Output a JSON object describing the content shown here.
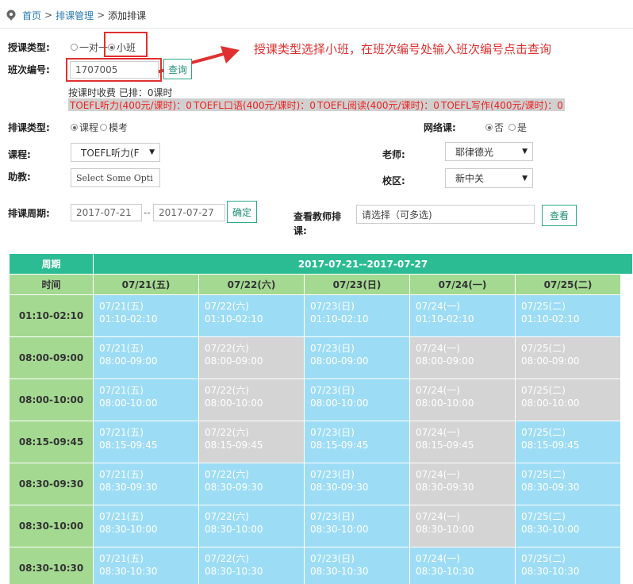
{
  "breadcrumb": {
    "home": "首页",
    "sep1": ">",
    "manage": "排课管理",
    "sep2": ">",
    "current": "添加排课"
  },
  "form": {
    "teach_type_label": "授课类型:",
    "teach_type_options": [
      "一对一",
      "小班"
    ],
    "class_no_label": "班次编号:",
    "class_no_value": "1707005",
    "query_button": "查询",
    "fee_info": "按课时收费 已排：0课时",
    "subjects": [
      "TOEFL听力(400元/课时)：0",
      "TOEFL口语(400元/课时)：0",
      "TOEFL阅读(400元/课时)：0",
      "TOEFL写作(400元/课时)：0"
    ],
    "sched_type_label": "排课类型:",
    "sched_type_options": [
      "课程",
      "模考"
    ],
    "online_label": "网络课:",
    "online_options": [
      "否",
      "是"
    ],
    "course_label": "课程:",
    "course_value": "TOEFL听力(F",
    "teacher_label": "老师:",
    "teacher_value": "耶律德光",
    "assistant_label": "助教:",
    "assistant_placeholder": "Select Some Opti",
    "campus_label": "校区:",
    "campus_value": "新中关",
    "period_label": "排课周期:",
    "date_from": "2017-07-21",
    "date_sep": "--",
    "date_to": "2017-07-27",
    "confirm_button": "确定",
    "view_teacher_label_1": "查看教师排",
    "view_teacher_label_2": "课:",
    "view_teacher_placeholder": "请选择（可多选)",
    "view_button": "查看"
  },
  "annotation": "授课类型选择小班，在班次编号处输入班次编号点击查询",
  "annotation_color": "#e03030",
  "schedule": {
    "week_header": "周期",
    "range_header": "2017-07-21--2017-07-27",
    "time_header": "时间",
    "days": [
      "07/21(五)",
      "07/22(六)",
      "07/23(日)",
      "07/24(一)",
      "07/25(二)"
    ],
    "rows": [
      {
        "time": "01:10-02:10",
        "cells": [
          {
            "l1": "07/21(五)",
            "l2": "01:10-02:10",
            "c": "blue"
          },
          {
            "l1": "07/22(六)",
            "l2": "01:10-02:10",
            "c": "blue"
          },
          {
            "l1": "07/23(日)",
            "l2": "01:10-02:10",
            "c": "blue"
          },
          {
            "l1": "07/24(一)",
            "l2": "01:10-02:10",
            "c": "blue"
          },
          {
            "l1": "07/25(二)",
            "l2": "01:10-02:10",
            "c": "blue"
          }
        ]
      },
      {
        "time": "08:00-09:00",
        "cells": [
          {
            "l1": "07/21(五)",
            "l2": "08:00-09:00",
            "c": "blue"
          },
          {
            "l1": "07/22(六)",
            "l2": "08:00-09:00",
            "c": "gray"
          },
          {
            "l1": "07/23(日)",
            "l2": "08:00-09:00",
            "c": "blue"
          },
          {
            "l1": "07/24(一)",
            "l2": "08:00-09:00",
            "c": "gray"
          },
          {
            "l1": "07/25(二)",
            "l2": "08:00-09:00",
            "c": "gray"
          }
        ]
      },
      {
        "time": "08:00-10:00",
        "cells": [
          {
            "l1": "07/21(五)",
            "l2": "08:00-10:00",
            "c": "blue"
          },
          {
            "l1": "07/22(六)",
            "l2": "08:00-10:00",
            "c": "gray"
          },
          {
            "l1": "07/23(日)",
            "l2": "08:00-10:00",
            "c": "blue"
          },
          {
            "l1": "07/24(一)",
            "l2": "08:00-10:00",
            "c": "gray"
          },
          {
            "l1": "07/25(二)",
            "l2": "08:00-10:00",
            "c": "gray"
          }
        ]
      },
      {
        "time": "08:15-09:45",
        "cells": [
          {
            "l1": "07/21(五)",
            "l2": "08:15-09:45",
            "c": "blue"
          },
          {
            "l1": "07/22(六)",
            "l2": "08:15-09:45",
            "c": "gray"
          },
          {
            "l1": "07/23(日)",
            "l2": "08:15-09:45",
            "c": "blue"
          },
          {
            "l1": "07/24(一)",
            "l2": "08:15-09:45",
            "c": "gray"
          },
          {
            "l1": "07/25(二)",
            "l2": "08:15-09:45",
            "c": "blue"
          }
        ]
      },
      {
        "time": "08:30-09:30",
        "cells": [
          {
            "l1": "07/21(五)",
            "l2": "08:30-09:30",
            "c": "blue"
          },
          {
            "l1": "07/22(六)",
            "l2": "08:30-09:30",
            "c": "blue"
          },
          {
            "l1": "07/23(日)",
            "l2": "08:30-09:30",
            "c": "blue"
          },
          {
            "l1": "07/24(一)",
            "l2": "08:30-09:30",
            "c": "gray"
          },
          {
            "l1": "07/25(二)",
            "l2": "08:30-09:30",
            "c": "blue"
          }
        ]
      },
      {
        "time": "08:30-10:00",
        "cells": [
          {
            "l1": "07/21(五)",
            "l2": "08:30-10:00",
            "c": "blue"
          },
          {
            "l1": "07/22(六)",
            "l2": "08:30-10:00",
            "c": "blue"
          },
          {
            "l1": "07/23(日)",
            "l2": "08:30-10:00",
            "c": "blue"
          },
          {
            "l1": "07/24(一)",
            "l2": "08:30-10:00",
            "c": "gray"
          },
          {
            "l1": "07/25(二)",
            "l2": "08:30-10:00",
            "c": "blue"
          }
        ]
      },
      {
        "time": "08:30-10:30",
        "cells": [
          {
            "l1": "07/21(五)",
            "l2": "08:30-10:30",
            "c": "blue"
          },
          {
            "l1": "07/22(六)",
            "l2": "08:30-10:30",
            "c": "blue"
          },
          {
            "l1": "07/23(日)",
            "l2": "08:30-10:30",
            "c": "blue"
          },
          {
            "l1": "07/24(一)",
            "l2": "08:30-10:30",
            "c": "blue"
          },
          {
            "l1": "07/25(二)",
            "l2": "08:30-10:30",
            "c": "blue"
          }
        ]
      }
    ]
  }
}
